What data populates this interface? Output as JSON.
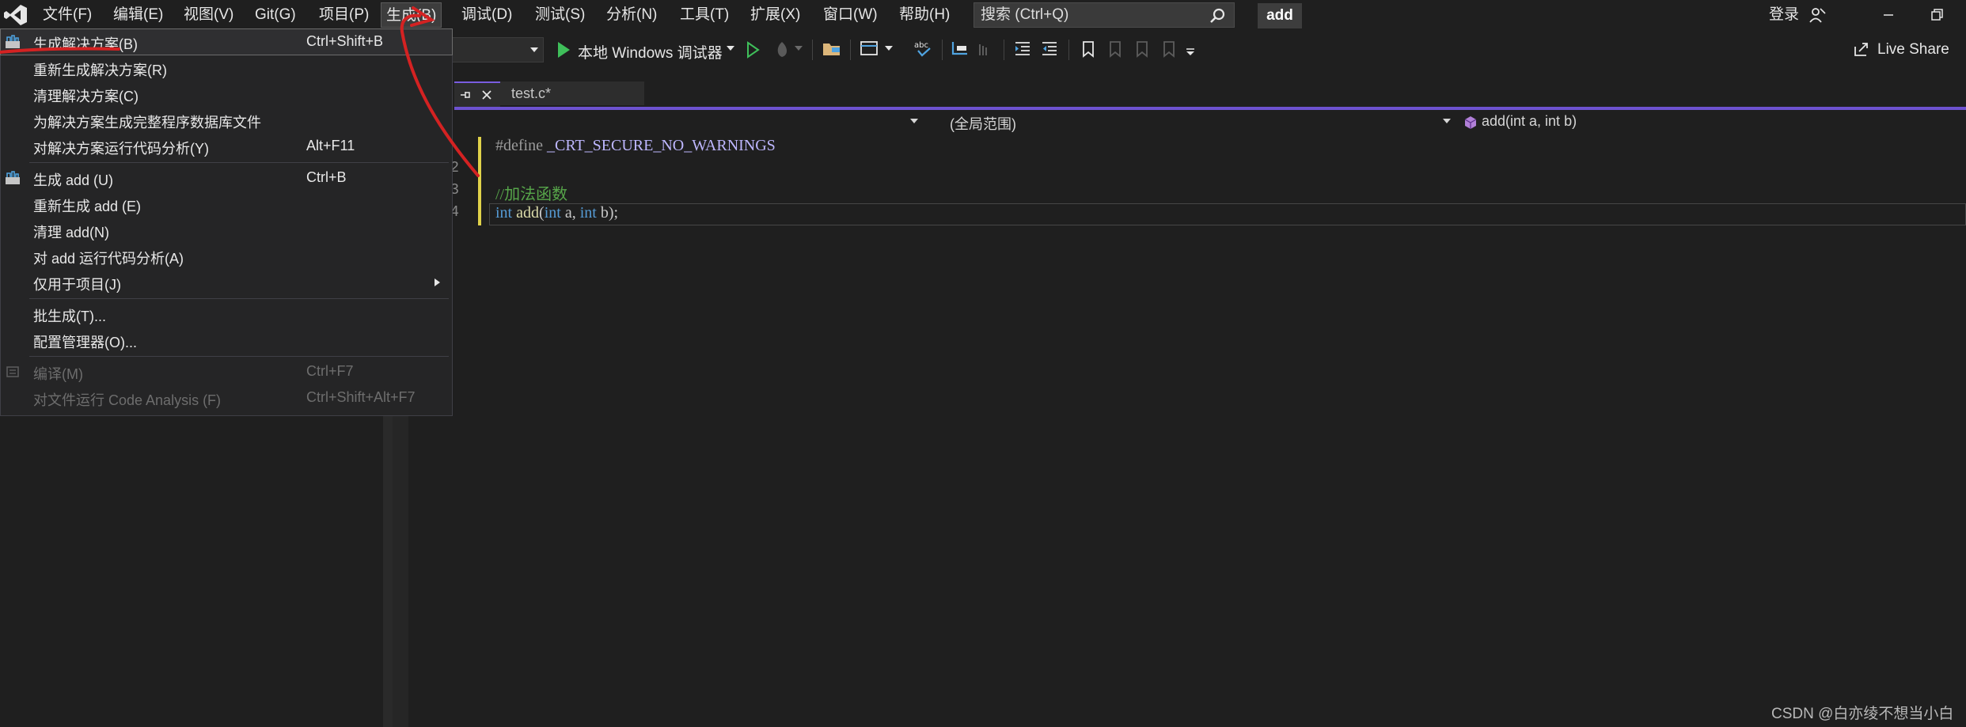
{
  "menubar": {
    "items": [
      "文件(F)",
      "编辑(E)",
      "视图(V)",
      "Git(G)",
      "项目(P)",
      "生成(B)",
      "调试(D)",
      "测试(S)",
      "分析(N)",
      "工具(T)",
      "扩展(X)",
      "窗口(W)",
      "帮助(H)"
    ],
    "search_placeholder": "搜索 (Ctrl+Q)",
    "solution_name": "add",
    "login": "登录"
  },
  "toolbar": {
    "run_target": "本地 Windows 调试器",
    "live_share": "Live Share"
  },
  "tabs": {
    "file_tab": "test.c*"
  },
  "navbar": {
    "scope": "(全局范围)",
    "function": "add(int a, int b)"
  },
  "editor": {
    "line_numbers": [
      "2",
      "3",
      "4"
    ],
    "line1": {
      "directive": "#define",
      "macro": "_CRT_SECURE_NO_WARNINGS"
    },
    "line3": {
      "comment": "//加法函数"
    },
    "line4": {
      "kw1": "int",
      "fn": "add",
      "p1": "(",
      "kw2": "int",
      "a": " a, ",
      "kw3": "int",
      "b": " b);"
    }
  },
  "build_menu": {
    "items": [
      {
        "label": "生成解决方案(B)",
        "shortcut": "Ctrl+Shift+B"
      },
      {
        "label": "重新生成解决方案(R)",
        "shortcut": ""
      },
      {
        "label": "清理解决方案(C)",
        "shortcut": ""
      },
      {
        "label": "为解决方案生成完整程序数据库文件",
        "shortcut": ""
      },
      {
        "label": "对解决方案运行代码分析(Y)",
        "shortcut": "Alt+F11"
      },
      {
        "label": "生成 add (U)",
        "shortcut": "Ctrl+B"
      },
      {
        "label": "重新生成 add (E)",
        "shortcut": ""
      },
      {
        "label": "清理 add(N)",
        "shortcut": ""
      },
      {
        "label": "对 add 运行代码分析(A)",
        "shortcut": ""
      },
      {
        "label": "仅用于项目(J)",
        "shortcut": ""
      },
      {
        "label": "批生成(T)...",
        "shortcut": ""
      },
      {
        "label": "配置管理器(O)...",
        "shortcut": ""
      },
      {
        "label": "编译(M)",
        "shortcut": "Ctrl+F7"
      },
      {
        "label": "对文件运行 Code Analysis (F)",
        "shortcut": "Ctrl+Shift+Alt+F7"
      }
    ]
  },
  "watermark": "CSDN @白亦绫不想当小白",
  "colors": {
    "accent": "#6d52d0",
    "annotation": "#d42222",
    "highlight_border": "#6c6c6c"
  }
}
